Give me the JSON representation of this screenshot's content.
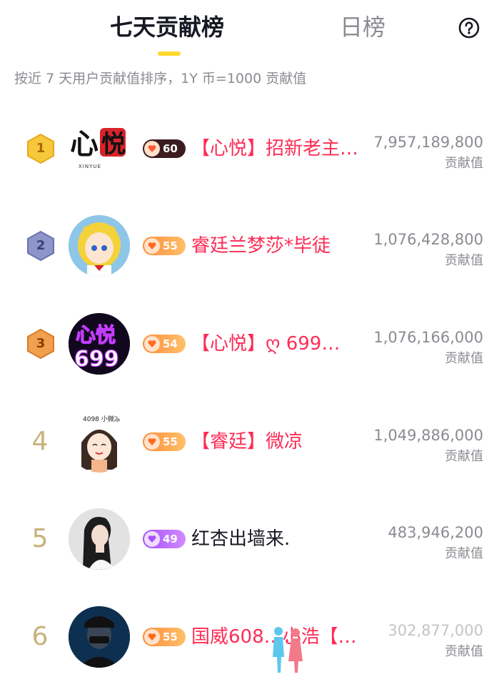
{
  "tabs": {
    "active": "七天贡献榜",
    "inactive": "日榜"
  },
  "subtitle": "按近 7 天用户贡献值排序，1Y 币=1000 贡献值",
  "help_icon": "question-circle-icon",
  "colors": {
    "accent_underline": "#fed82e",
    "name_red": "#fe2c55",
    "gold_rank": "#c9b27c"
  },
  "rows": [
    {
      "rank": "1",
      "level": "60",
      "name": "【心悦】招新老主…",
      "score": "7,957,189,800",
      "score_label": "贡献值"
    },
    {
      "rank": "2",
      "level": "55",
      "name": "睿廷兰梦莎*毕徒",
      "score": "1,076,428,800",
      "score_label": "贡献值"
    },
    {
      "rank": "3",
      "level": "54",
      "name": "【心悦】ღ 699…",
      "score": "1,076,166,000",
      "score_label": "贡献值"
    },
    {
      "rank": "4",
      "level": "55",
      "name": "【睿廷】微凉",
      "score": "1,049,886,000",
      "score_label": "贡献值"
    },
    {
      "rank": "5",
      "level": "49",
      "name": "红杏出墙来.",
      "score": "483,946,200",
      "score_label": "贡献值"
    },
    {
      "rank": "6",
      "level": "55",
      "name": "国威608…小浩【…",
      "score": "302,877,000",
      "score_label": "贡献值"
    }
  ]
}
